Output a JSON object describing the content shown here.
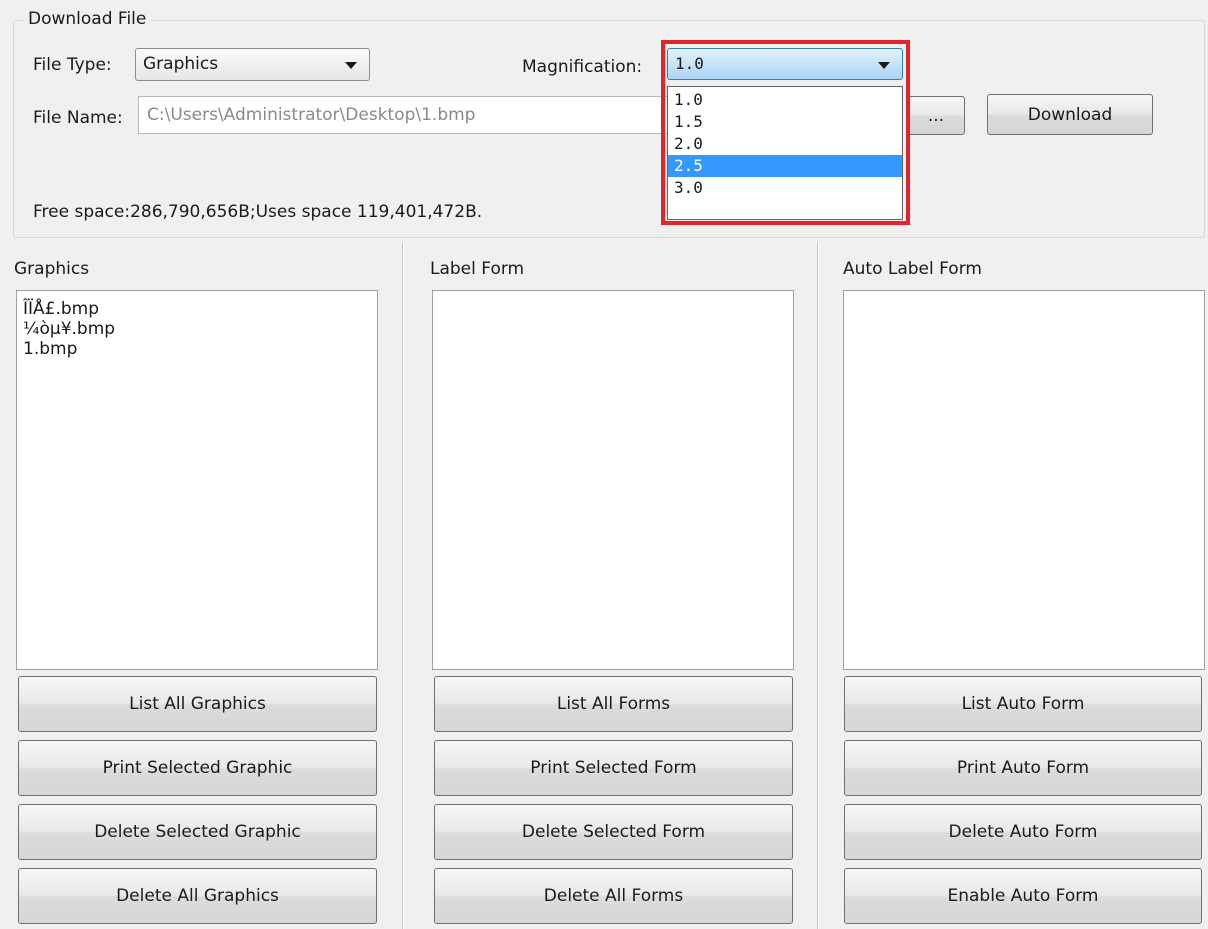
{
  "download": {
    "group_title": "Download File",
    "file_type_label": "File Type:",
    "file_type_value": "Graphics",
    "magnification_label": "Magnification:",
    "magnification_value": "1.0",
    "magnification_options": [
      "1.0",
      "1.5",
      "2.0",
      "2.5",
      "3.0"
    ],
    "magnification_highlighted": "2.5",
    "file_name_label": "File Name:",
    "file_name_value": "C:\\Users\\Administrator\\Desktop\\1.bmp",
    "browse_label": "...",
    "download_label": "Download",
    "space_info": "Free space:286,790,656B;Uses space 119,401,472B."
  },
  "panels": {
    "graphics": {
      "title": "Graphics",
      "items": [
        "ÎÏÅ£.bmp",
        "¼òµ¥.bmp",
        "1.bmp"
      ],
      "buttons": [
        "List All Graphics",
        "Print Selected Graphic",
        "Delete Selected Graphic",
        "Delete All Graphics"
      ]
    },
    "label_form": {
      "title": "Label Form",
      "items": [],
      "buttons": [
        "List All Forms",
        "Print Selected Form",
        "Delete Selected Form",
        "Delete All Forms"
      ]
    },
    "auto_label_form": {
      "title": "Auto Label Form",
      "items": [],
      "buttons": [
        "List Auto Form",
        "Print Auto Form",
        "Delete Auto Form",
        "Enable Auto Form"
      ]
    }
  },
  "colors": {
    "highlight": "#e0262c",
    "selection": "#3399ff"
  }
}
